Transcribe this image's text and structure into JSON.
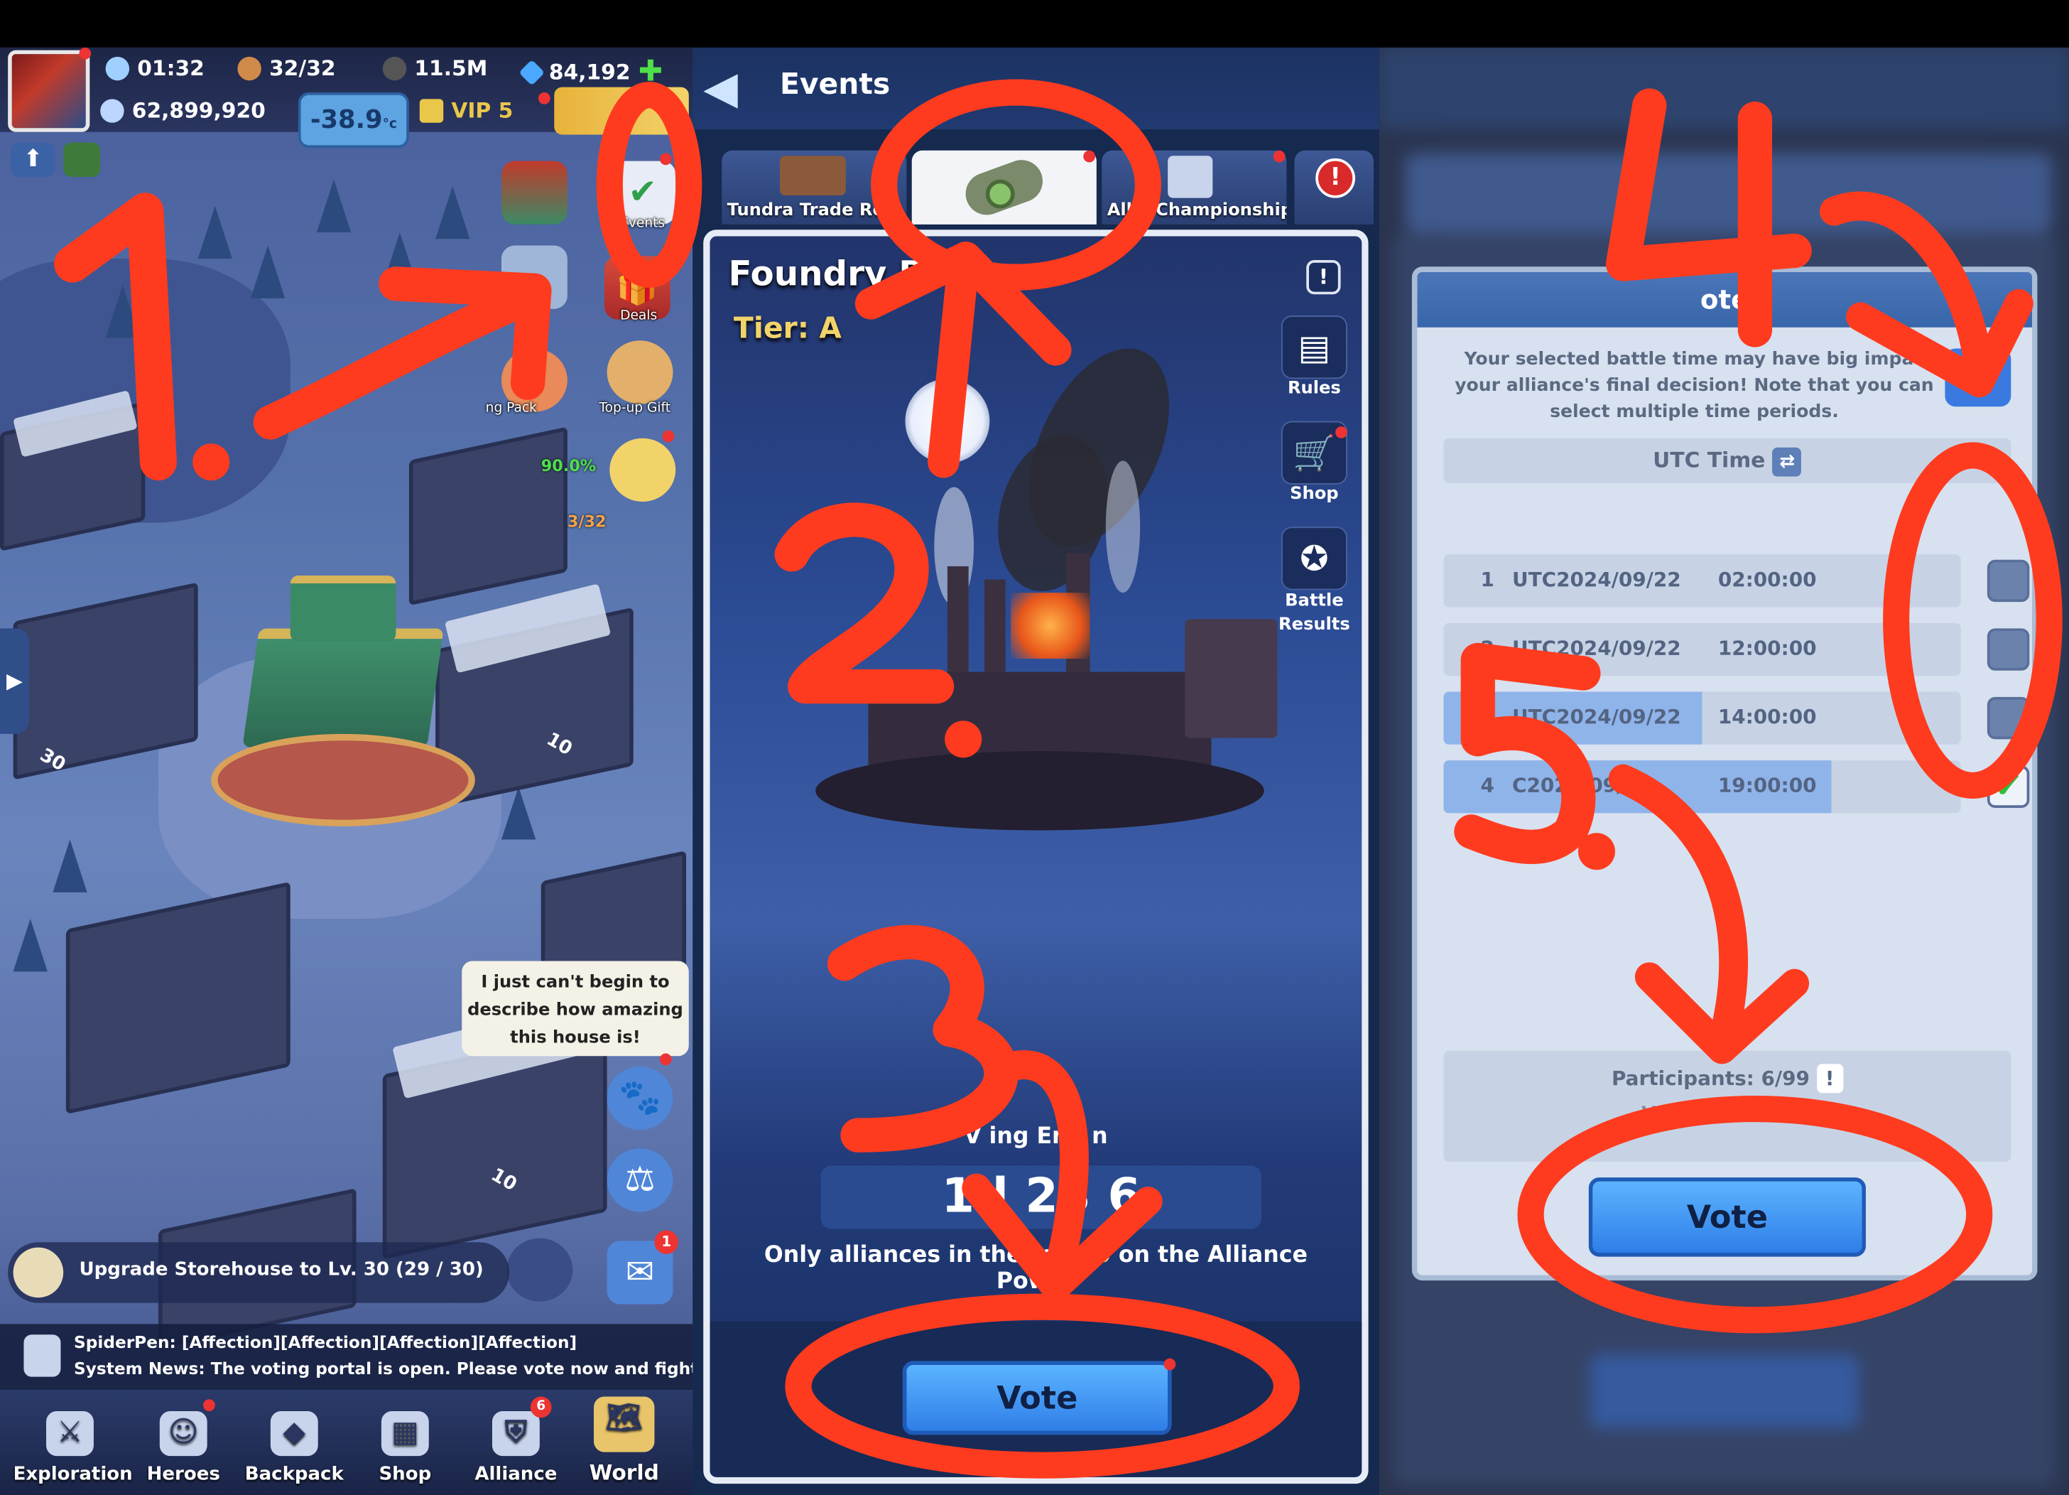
{
  "panel1": {
    "status": {
      "time": "01:32",
      "stamina": "32/32",
      "coal": "11.5M",
      "gems": "84,192",
      "power": "62,899,920",
      "temperature": "-38.9",
      "temperature_unit": "°c",
      "vip": "VIP 5"
    },
    "side_icons": {
      "events": "Events",
      "deals": "Deals",
      "pack": "ng Pack",
      "topup": "Top-up Gift"
    },
    "city_labels": {
      "progress_pct": "90.0%",
      "count": "3/32",
      "lvl_a": "30",
      "lvl_b": "10",
      "lvl_c": "10"
    },
    "speech_bubble": "I just can't begin to describe how amazing this house is!",
    "task": "Upgrade Storehouse to Lv. 30 (29 / 30)",
    "news": {
      "line1": "SpiderPen: [Affection][Affection][Affection][Affection]",
      "line2": "System News: The voting portal is open. Please vote now and fight for t!"
    },
    "mail_badge": "1",
    "alliance_badge": "6",
    "nav": [
      "Exploration",
      "Heroes",
      "Backpack",
      "Shop",
      "Alliance",
      "World"
    ]
  },
  "panel2": {
    "header_title": "Events",
    "tabs": [
      "Tundra Trade Ro",
      "",
      "All e Championship",
      "!"
    ],
    "event_title": "Foundry B",
    "tier": "Tier: A",
    "side_buttons": [
      "Rules",
      "Shop",
      "Battle Results"
    ],
    "voting_ends_label": "V ing End n",
    "timer": "1d 23 6",
    "notice_a": "Only alliances in the top ",
    "notice_top": "20",
    "notice_b": " on the Alliance Power",
    "vote_label": "Vote"
  },
  "panel3": {
    "dialog_title": "ote",
    "description": "Your selected battle time may have big impac your alliance's final decision! Note that you can select multiple time periods.",
    "utc_header": "UTC Time",
    "rows": [
      {
        "idx": "1",
        "date": "UTC2024/09/22",
        "time": "02:00:00",
        "checked": false
      },
      {
        "idx": "2",
        "date": "UTC2024/09/22",
        "time": "12:00:00",
        "checked": false
      },
      {
        "idx": "3",
        "date": "UTC2024/09/22",
        "time": "14:00:00",
        "checked": false
      },
      {
        "idx": "4",
        "date": "C2024/09/22",
        "time": "19:00:00",
        "checked": true
      }
    ],
    "participants": "Participants: 6/99",
    "vote_info": "Vote in",
    "vote_label": "Vote"
  },
  "annotations": {
    "step1": "1.",
    "step2": "2.",
    "step3": "3.",
    "step4": "4.",
    "step5": "5."
  },
  "colors": {
    "annotation": "#ff3b1f",
    "vote_button": "#3a8ef0"
  }
}
